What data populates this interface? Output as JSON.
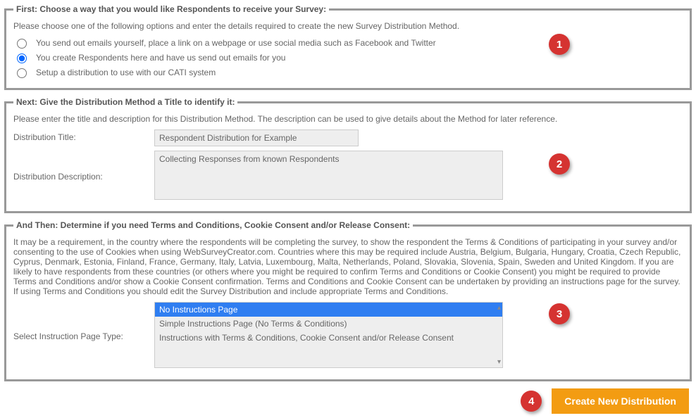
{
  "section1": {
    "legend": "First: Choose a way that you would like Respondents to receive your Survey:",
    "intro": "Please choose one of the following options and enter the details required to create the new Survey Distribution Method.",
    "options": [
      "You send out emails yourself, place a link on a webpage or use social media such as Facebook and Twitter",
      "You create Respondents here and have us send out emails for you",
      "Setup a distribution to use with our CATI system"
    ],
    "bubble": "1"
  },
  "section2": {
    "legend": "Next: Give the Distribution Method a Title to identify it:",
    "intro": "Please enter the title and description for this Distribution Method. The description can be used to give details about the Method for later reference.",
    "title_label": "Distribution Title:",
    "title_value": "Respondent Distribution for Example",
    "desc_label": "Distribution Description:",
    "desc_value": "Collecting Responses from known Respondents",
    "bubble": "2"
  },
  "section3": {
    "legend": "And Then: Determine if you need Terms and Conditions, Cookie Consent and/or Release Consent:",
    "intro": "It may be a requirement, in the country where the respondents will be completing the survey, to show the respondent the Terms & Conditions of participating in your survey and/or consenting to the use of Cookies when using WebSurveyCreator.com. Countries where this may be required include Austria, Belgium, Bulgaria, Hungary, Croatia, Czech Republic, Cyprus, Denmark, Estonia, Finland, France, Germany, Italy, Latvia, Luxembourg, Malta, Netherlands, Poland, Slovakia, Slovenia, Spain, Sweden and United Kingdom. If you are likely to have respondents from these countries (or others where you might be required to confirm Terms and Conditions or Cookie Consent) you might be required to provide Terms and Conditions and/or show a Cookie Consent confirmation. Terms and Conditions and Cookie Consent can be undertaken by providing an instructions page for the survey. If using Terms and Conditions you should edit the Survey Distribution and include appropriate Terms and Conditions.",
    "list_label": "Select Instruction Page Type:",
    "options": [
      "No Instructions Page",
      "Simple Instructions Page (No Terms & Conditions)",
      "Instructions with Terms & Conditions, Cookie Consent and/or Release Consent"
    ],
    "bubble": "3"
  },
  "footer": {
    "bubble": "4",
    "button": "Create New Distribution"
  }
}
